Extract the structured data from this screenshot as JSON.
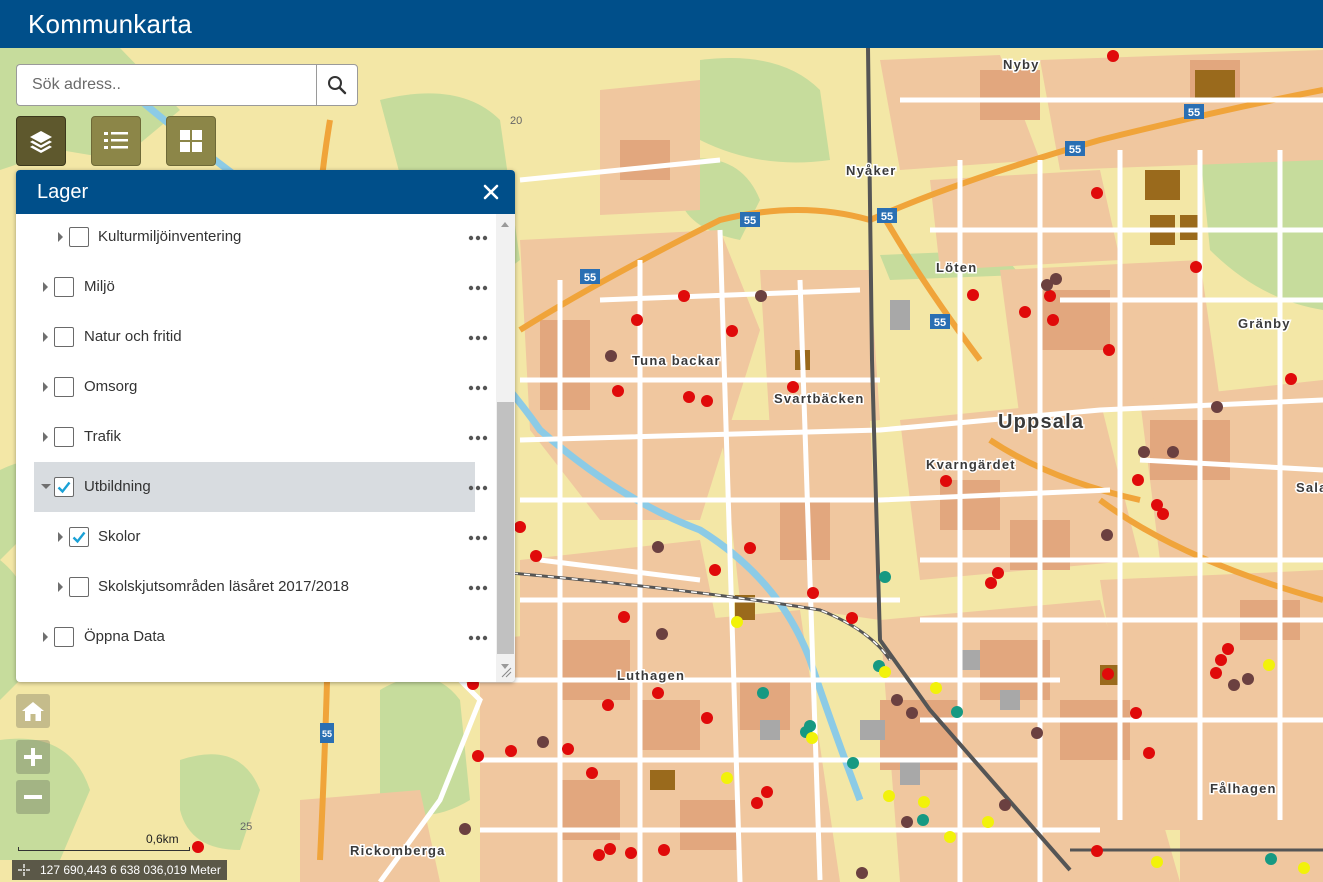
{
  "app": {
    "title": "Kommunkarta"
  },
  "search": {
    "placeholder": "Sök adress..",
    "value": "",
    "button_icon": "search-icon"
  },
  "toolbar": {
    "buttons": [
      {
        "name": "layers-button",
        "icon": "layers-icon",
        "active": true
      },
      {
        "name": "legend-button",
        "icon": "list-icon",
        "active": false
      },
      {
        "name": "basemap-button",
        "icon": "grid-icon",
        "active": false
      }
    ]
  },
  "layer_panel": {
    "title": "Lager",
    "close_icon": "close-icon",
    "items": [
      {
        "label": "Kulturmiljöinventering",
        "level": 1,
        "checked": false,
        "expanded": false,
        "selected": false
      },
      {
        "label": "Miljö",
        "level": 0,
        "checked": false,
        "expanded": false,
        "selected": false
      },
      {
        "label": "Natur och fritid",
        "level": 0,
        "checked": false,
        "expanded": false,
        "selected": false
      },
      {
        "label": "Omsorg",
        "level": 0,
        "checked": false,
        "expanded": false,
        "selected": false
      },
      {
        "label": "Trafik",
        "level": 0,
        "checked": false,
        "expanded": false,
        "selected": false
      },
      {
        "label": "Utbildning",
        "level": 0,
        "checked": true,
        "expanded": true,
        "selected": true
      },
      {
        "label": "Skolor",
        "level": 1,
        "checked": true,
        "expanded": false,
        "selected": false
      },
      {
        "label": "Skolskjutsområden läsåret 2017/2018",
        "level": 1,
        "checked": false,
        "expanded": false,
        "selected": false
      },
      {
        "label": "Öppna Data",
        "level": 0,
        "checked": false,
        "expanded": false,
        "selected": false
      }
    ]
  },
  "map": {
    "place_labels": [
      {
        "text": "Nyby"
      },
      {
        "text": "Nyåker"
      },
      {
        "text": "Löten"
      },
      {
        "text": "Gränby"
      },
      {
        "text": "Tuna backar"
      },
      {
        "text": "Svartbäcken"
      },
      {
        "text": "Uppsala"
      },
      {
        "text": "Kvarngärdet"
      },
      {
        "text": "Sala"
      },
      {
        "text": "Luthagen"
      },
      {
        "text": "Fålhagen"
      },
      {
        "text": "Rickomberga"
      }
    ],
    "road_shields": [
      {
        "text": "55"
      },
      {
        "text": "55"
      },
      {
        "text": "55"
      },
      {
        "text": "55"
      },
      {
        "text": "55"
      },
      {
        "text": "55"
      },
      {
        "text": "55"
      }
    ],
    "route_numbers": [
      {
        "text": "20"
      },
      {
        "text": "25"
      }
    ],
    "colors": {
      "red": "#e00a0a",
      "purple": "#6b4040",
      "teal": "#169982",
      "yellow": "#f2f20a",
      "built": "#e2a77e",
      "block": "#f0c79f",
      "road": "#ffffff",
      "green": "#c6dc9c",
      "background": "#f3e7a6",
      "water": "#8ccbe6"
    }
  },
  "map_controls": {
    "home_icon": "home-icon",
    "zoom_in_icon": "plus-icon",
    "zoom_out_icon": "minus-icon"
  },
  "scale": {
    "label": "0,6km"
  },
  "coordinates": {
    "icon": "crosshair-icon",
    "text": "127 690,443 6 638 036,019 Meter"
  }
}
